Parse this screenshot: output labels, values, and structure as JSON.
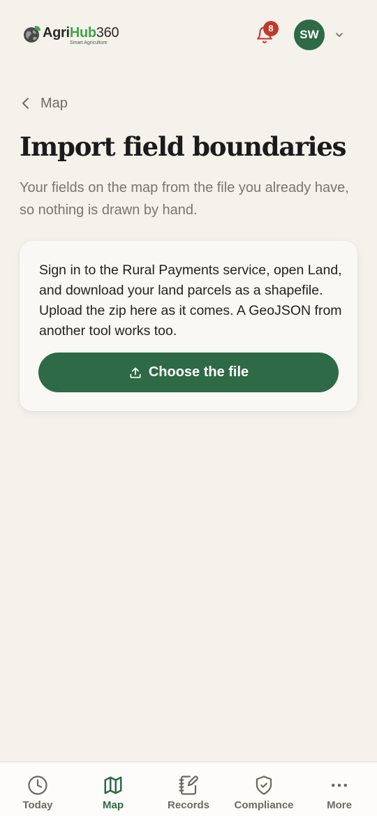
{
  "header": {
    "logo": {
      "word_agri": "Agri",
      "word_hub": "Hub",
      "word_num": "360",
      "tagline": "Smart Agriculture",
      "icon": "globe-leaf-icon"
    },
    "notifications": {
      "count": "8",
      "icon": "bell-icon"
    },
    "user": {
      "initials": "SW",
      "menu_icon": "chevron-down-icon"
    }
  },
  "breadcrumb": {
    "back_label": "Map",
    "icon": "chevron-left-icon"
  },
  "main": {
    "title": "Import field boundaries",
    "subtitle": "Your fields on the map from the file you already have, so nothing is drawn by hand.",
    "card": {
      "text": "Sign in to the Rural Payments service, open Land, and download your land parcels as a shapefile. Upload the zip here as it comes. A GeoJSON from another tool works too.",
      "button_label": "Choose the file",
      "button_icon": "upload-icon"
    }
  },
  "bottom_nav": {
    "items": [
      {
        "label": "Today",
        "icon": "clock-icon",
        "active": false
      },
      {
        "label": "Map",
        "icon": "map-icon",
        "active": true
      },
      {
        "label": "Records",
        "icon": "notebook-pen-icon",
        "active": false
      },
      {
        "label": "Compliance",
        "icon": "shield-check-icon",
        "active": false
      },
      {
        "label": "More",
        "icon": "more-dots-icon",
        "active": false
      }
    ]
  },
  "colors": {
    "brand_green": "#2d6a45",
    "logo_green": "#3fa64a",
    "badge_red": "#c0392b",
    "background": "#f5f2ec"
  }
}
